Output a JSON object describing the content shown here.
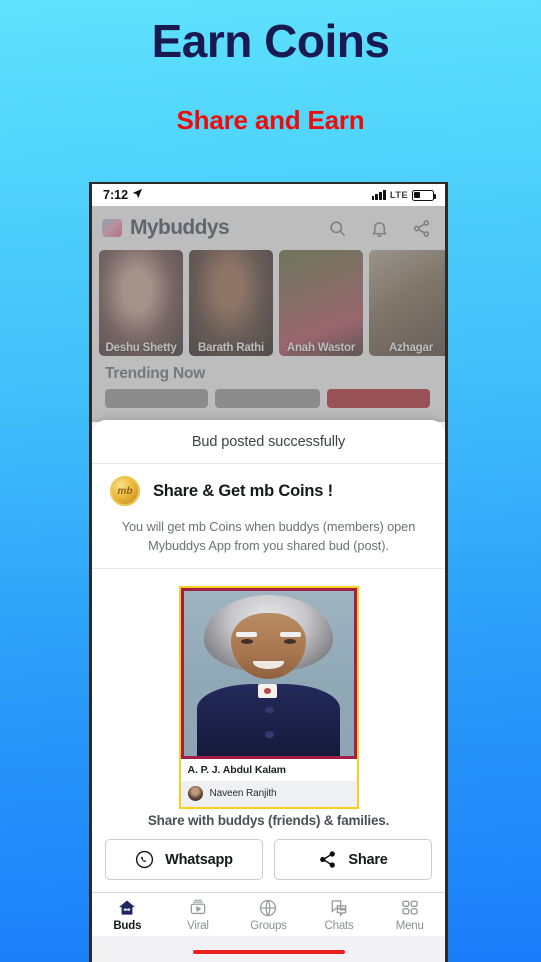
{
  "promo": {
    "title": "Earn Coins",
    "subtitle": "Share and Earn",
    "title_color": "#1a1a52",
    "subtitle_color": "#f00b0b",
    "bg_top_color": "#5fe2fc",
    "bg_bottom_color": "#1a7dfa"
  },
  "status_bar": {
    "time": "7:12",
    "location_icon": "location-arrow-icon",
    "network": "LTE",
    "signal_icon": "signal-bars-icon",
    "battery_icon": "battery-icon"
  },
  "app_bar": {
    "logo_icon": "mybuddys-logo-icon",
    "app_name": "Mybuddys",
    "icons": [
      {
        "name": "search-icon"
      },
      {
        "name": "notification-bell-icon"
      },
      {
        "name": "share-icon"
      }
    ]
  },
  "stories": [
    {
      "name": "Deshu Shetty"
    },
    {
      "name": "Barath Rathi"
    },
    {
      "name": "Anah Wastor"
    },
    {
      "name": "Azhagar"
    }
  ],
  "trending": {
    "heading": "Trending Now",
    "chips": [
      "",
      "",
      ""
    ]
  },
  "sheet": {
    "title": "Bud posted successfully",
    "coin_icon_label": "mb",
    "coin_heading": "Share & Get mb Coins !",
    "coin_description": "You will get mb Coins when buddys (members) open Mybuddys App from you shared bud (post).",
    "card": {
      "caption": "A. P. J. Abdul Kalam",
      "author": "Naveen Ranjith",
      "photo_border_color": "#a51e46",
      "frame_border_color": "#f5cf22"
    },
    "share_label": "Share with buddys (friends) & families.",
    "buttons": [
      {
        "label": "Whatsapp",
        "icon": "whatsapp-icon"
      },
      {
        "label": "Share",
        "icon": "share-icon"
      }
    ]
  },
  "bottom_nav": {
    "active": "Buds",
    "items": [
      {
        "label": "Buds",
        "icon": "home-icon"
      },
      {
        "label": "Viral",
        "icon": "video-play-icon"
      },
      {
        "label": "Groups",
        "icon": "globe-icon"
      },
      {
        "label": "Chats",
        "icon": "chat-icon"
      },
      {
        "label": "Menu",
        "icon": "grid-menu-icon"
      }
    ],
    "home_indicator_color": "#e82020"
  }
}
